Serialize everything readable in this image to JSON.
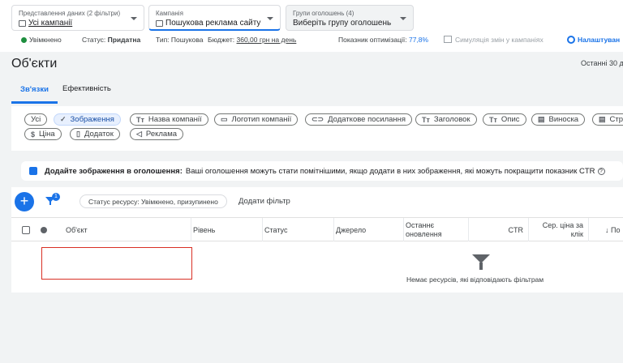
{
  "header": {
    "view_selector": {
      "label": "Представлення даних (2 фільтри)",
      "value": "Усі кампанії"
    },
    "campaign_selector": {
      "label": "Кампанія",
      "value": "Пошукова реклама сайту"
    },
    "adgroup_selector": {
      "label": "Групи оголошень (4)",
      "value": "Виберіть групу оголошень"
    }
  },
  "status_row": {
    "state": "Увімкнено",
    "status_label": "Статус:",
    "status_value": "Придатна",
    "type_label": "Тип:",
    "type_value": "Пошукова",
    "budget_label": "Бюджет:",
    "budget_value": "360,00 грн на день",
    "opt_label": "Показник оптимізації:",
    "opt_value": "77,8%",
    "simulation": "Симуляція змін у кампаніях",
    "settings": "Налаштуван"
  },
  "page": {
    "title": "Об'єкти",
    "date_range": "Останні 30 д"
  },
  "tabs": [
    "Зв'язки",
    "Ефективність"
  ],
  "chips": {
    "all": "Усі",
    "images": "Зображення",
    "company_name": "Назва компанії",
    "logo": "Логотип компанії",
    "sitelink": "Додаткове посилання",
    "headline": "Заголовок",
    "description": "Опис",
    "callout": "Виноска",
    "structured": "Стр",
    "price": "Ціна",
    "app": "Додаток",
    "promo": "Реклама"
  },
  "banner": {
    "title": "Додайте зображення в оголошення:",
    "text": "Ваші оголошення можуть стати помітнішими, якщо додати в них зображення, які можуть покращити показник CTR"
  },
  "toolbar": {
    "add": "+",
    "filter_count": "1",
    "filter_chip": "Статус ресурсу: Увімкнено, призупинено",
    "add_filter": "Додати фільтр"
  },
  "table": {
    "columns": {
      "asset": "Об'єкт",
      "level": "Рівень",
      "status": "Статус",
      "source": "Джерело",
      "updated": "Останнє оновлення",
      "ctr": "CTR",
      "avg_cpc": "Сер. ціна за клік",
      "sort": "↓ По"
    },
    "empty_message": "Немає ресурсів, які відповідають фільтрам"
  },
  "colors": {
    "accent": "#1a73e8",
    "enabled": "#1e8e3e",
    "highlight_box": "#d93025"
  }
}
